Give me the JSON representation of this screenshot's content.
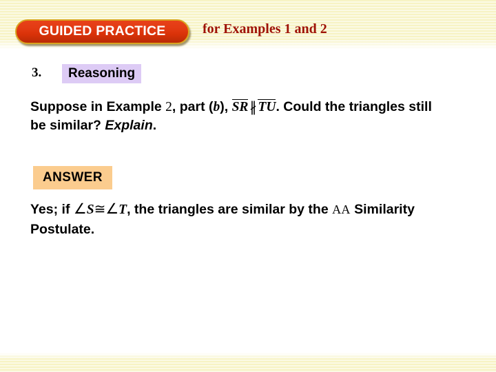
{
  "header": {
    "badge_label": "GUIDED PRACTICE",
    "subtitle": "for Examples 1 and 2",
    "badge_fill": "#d93208",
    "badge_border": "#d9a520",
    "subtitle_color": "#9e1206",
    "band_color": "#f7f3c4"
  },
  "question": {
    "number": "3.",
    "tag_label": "Reasoning",
    "tag_highlight": "#ddcbf5",
    "text_part1": "Suppose in Example ",
    "example_number": "2",
    "text_part2": ", part (",
    "part_letter": "b",
    "text_part3": "), ",
    "segment_1": "SR",
    "relation_symbol": "∦",
    "relation_name": "not-parallel",
    "segment_2": "TU",
    "text_part4": ". Could the triangles still be similar? ",
    "emphasis": "Explain",
    "text_part5": "."
  },
  "answer": {
    "tag_label": "ANSWER",
    "tag_highlight": "#fbcc8e",
    "text_part1": "Yes; if ",
    "angle_symbol_1": "∠",
    "vertex_1": "S",
    "congruent_symbol": "≅",
    "angle_symbol_2": "∠",
    "vertex_2": "T",
    "text_part2": ", the triangles are similar by the ",
    "postulate_abbrev": "AA",
    "text_part3": " Similarity Postulate."
  }
}
